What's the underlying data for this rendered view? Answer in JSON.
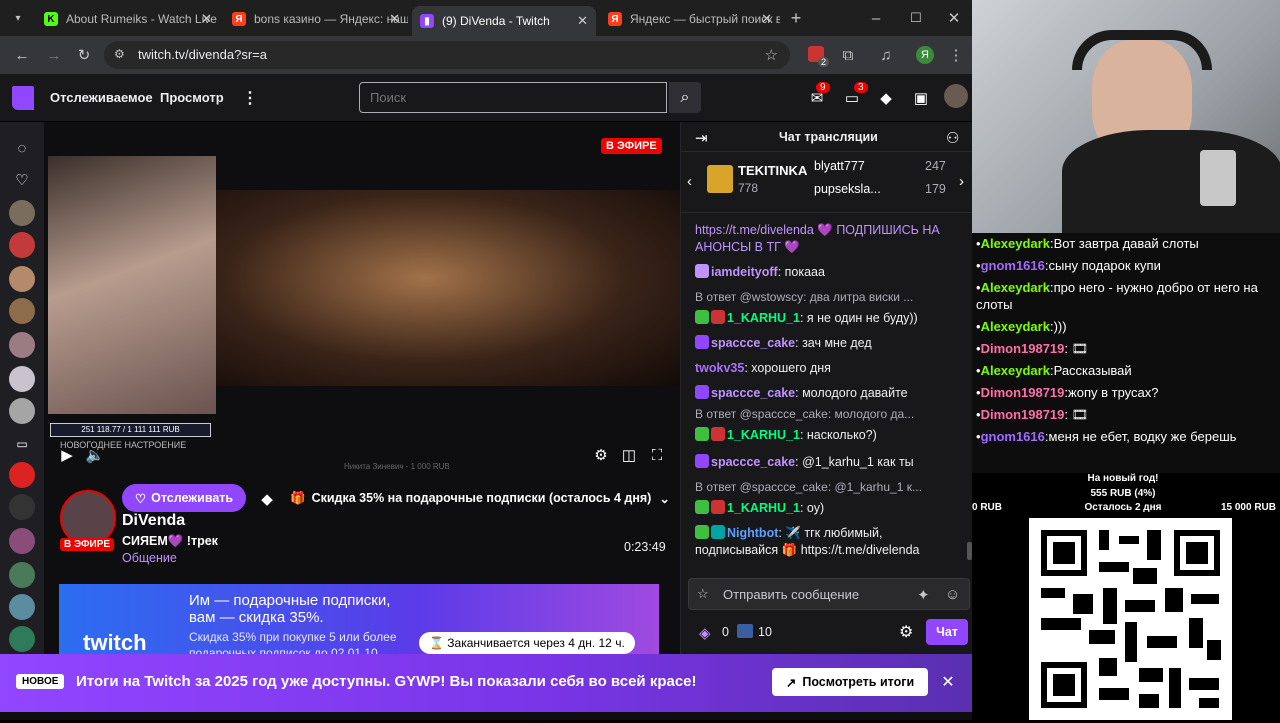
{
  "browser": {
    "tabs": [
      {
        "title": "About Rumeiks - Watch Live",
        "icon": "kick-icon"
      },
      {
        "title": "bons казино — Яндекс: нашлось",
        "icon": "yandex-icon"
      },
      {
        "title": "(9) DiVenda - Twitch",
        "icon": "twitch-icon"
      },
      {
        "title": "Яндекс — быстрый поиск в",
        "icon": "yandex-icon"
      }
    ],
    "url": "twitch.tv/divenda?sr=a",
    "ext_badge": "2",
    "profile_initial": "Я"
  },
  "twitch": {
    "nav": {
      "following": "Отслеживаемое",
      "browse": "Просмотр",
      "more": "⋮"
    },
    "search": {
      "placeholder": "Поиск"
    },
    "inbox_count": "9",
    "notif_count": "3",
    "player": {
      "live_badge": "В ЭФИРЕ",
      "goal": "251 118.77 / 1 111 111 RUB",
      "goal_caption": "НОВОГОДНЕЕ НАСТРОЕНИЕ",
      "caption": "Никита Зиневич - 1 000 RUB"
    },
    "channel": {
      "name": "DiVenda",
      "live_badge": "В ЭФИРЕ",
      "title": "СИЯЕМ💜 !трек",
      "category": "Общение",
      "uptime": "0:23:49",
      "follow_label": "Отслеживать",
      "promo_label": "Скидка 35% на подарочные подписки (осталось 4 дня)"
    },
    "banner": {
      "logo": "twitch",
      "line1": "Им — подарочные подписки,",
      "line2": "вам — скидка 35%.",
      "line3": "Скидка 35% при покупке 5 или более",
      "line4": "подарочных подписок до 02.01.10",
      "timer": "Заканчивается через 4 дн. 12 ч."
    },
    "notice": {
      "tag": "НОВОЕ",
      "text": "Итоги на Twitch за 2025 год уже доступны.  GYWP! Вы показали себя во всей красе!",
      "button": "Посмотреть итоги",
      "close": "✕"
    },
    "chat": {
      "header": "Чат трансляции",
      "gifters": [
        {
          "name": "TEKITINKA",
          "count": "778"
        },
        {
          "name": "blyatt777",
          "count": "247"
        },
        {
          "name": "pupseksla...",
          "count": "179"
        }
      ],
      "messages": [
        {
          "user": "",
          "color": "#bf94ff",
          "text": "https://t.me/divelenda 💜 ПОДПИШИСЬ НА АНОНСЫ В ТГ 💜",
          "reply": ""
        },
        {
          "user": "iamdeityoff",
          "color": "#bf94ff",
          "text": "покааа",
          "reply": ""
        },
        {
          "user": "1_KARHU_1",
          "color": "#00ff7f",
          "text": "я не один не буду))",
          "reply": "В ответ @wstowscy: два литра виски ..."
        },
        {
          "user": "spaccce_cake",
          "color": "#bf94ff",
          "text": "зач мне дед",
          "reply": ""
        },
        {
          "user": "twokv35",
          "color": "#a970ff",
          "text": "хорошего дня",
          "reply": ""
        },
        {
          "user": "spaccce_cake",
          "color": "#bf94ff",
          "text": "молодого давайте",
          "reply": ""
        },
        {
          "user": "1_KARHU_1",
          "color": "#00ff7f",
          "text": "насколько?)",
          "reply": "В ответ @spaccce_cake: молодого да..."
        },
        {
          "user": "spaccce_cake",
          "color": "#bf94ff",
          "text": "@1_karhu_1 как ты",
          "reply": ""
        },
        {
          "user": "1_KARHU_1",
          "color": "#00ff7f",
          "text": "оу)",
          "reply": "В ответ @spaccce_cake: @1_karhu_1 к..."
        },
        {
          "user": "Nightbot",
          "color": "#5ea0ff",
          "text": "✈️ тгк любимый, подписывайся 🎁 https://t.me/divelenda",
          "reply": ""
        }
      ],
      "input_placeholder": "Отправить сообщение",
      "points": "0",
      "points2": "10",
      "send": "Чат"
    }
  },
  "overlay": {
    "chat": [
      {
        "user": "Alexeydark",
        "color": "#7cfc00",
        "text": "Вот завтра давай слоты"
      },
      {
        "user": "gnom1616",
        "color": "#a26bff",
        "text": "сыну подарок купи"
      },
      {
        "user": "Alexeydark",
        "color": "#7cfc00",
        "text": "про него - нужно добро от него на слоты"
      },
      {
        "user": "Alexeydark",
        "color": "#7cfc00",
        "text": ")))"
      },
      {
        "user": "Dimon198719",
        "color": "#ff6fa8",
        "text": "🎞"
      },
      {
        "user": "Alexeydark",
        "color": "#7cfc00",
        "text": "Рассказывай"
      },
      {
        "user": "Dimon198719",
        "color": "#ff6fa8",
        "text": "жопу в трусах?"
      },
      {
        "user": "Dimon198719",
        "color": "#ff6fa8",
        "text": "🎞"
      },
      {
        "user": "gnom1616",
        "color": "#a26bff",
        "text": "меня не ебет, водку же берешь"
      }
    ],
    "goal": {
      "title": "На новый год!",
      "amount": "555 RUB (4%)",
      "min": "0 RUB",
      "remaining": "Осталось 2 дня",
      "max": "15 000 RUB",
      "progress": 0.04
    }
  }
}
